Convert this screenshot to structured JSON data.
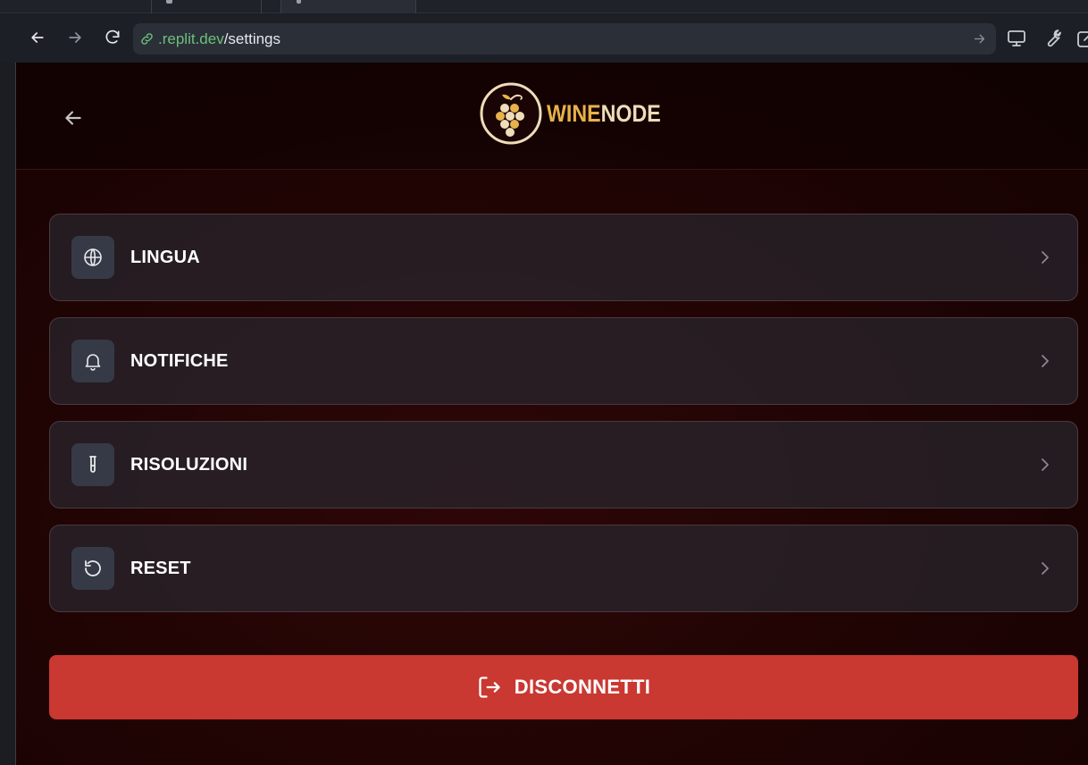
{
  "browser": {
    "url_domain": ".replit.dev",
    "url_path": "/settings",
    "icons": {
      "back": "arrow-left-icon",
      "forward": "arrow-right-icon",
      "reload": "reload-icon",
      "link": "link-icon",
      "go": "arrow-right-icon",
      "tools": [
        "monitor-icon",
        "wrench-icon",
        "external-window-icon"
      ]
    }
  },
  "app": {
    "brand": {
      "part1": "WINE",
      "part2": "NODE",
      "logo_icon": "grapes-icon"
    },
    "back_icon": "arrow-left-icon",
    "settings": [
      {
        "label": "LINGUA",
        "icon": "globe-icon"
      },
      {
        "label": "NOTIFICHE",
        "icon": "bell-icon"
      },
      {
        "label": "RISOLUZIONI",
        "icon": "test-tube-icon"
      },
      {
        "label": "RESET",
        "icon": "rotate-ccw-icon"
      }
    ],
    "logout": {
      "label": "DISCONNETTI",
      "icon": "log-out-icon"
    }
  },
  "colors": {
    "accent_gold": "#e7b24a",
    "logout_red": "#c93831",
    "background_wine": "#200404",
    "url_domain_green": "#6cc07a"
  }
}
